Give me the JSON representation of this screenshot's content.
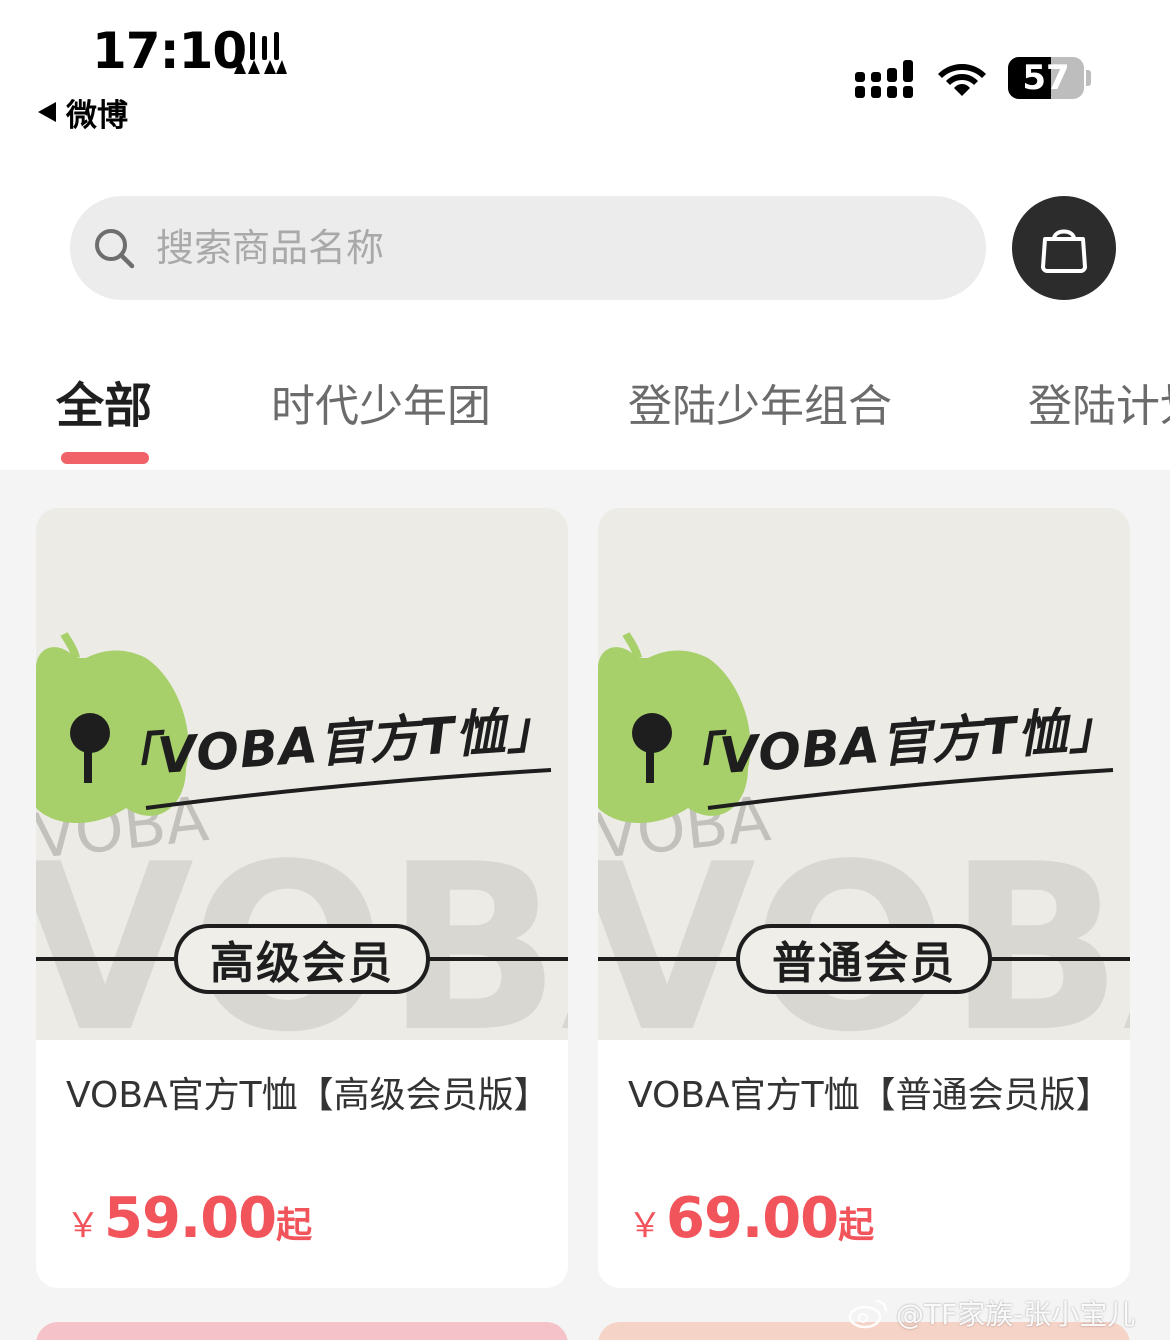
{
  "status_bar": {
    "time": "17:10",
    "back_app": "微博",
    "battery": "57",
    "battery_level_percent": 57
  },
  "search": {
    "placeholder": "搜索商品名称"
  },
  "tabs": [
    {
      "label": "全部",
      "active": true
    },
    {
      "label": "时代少年团",
      "active": false
    },
    {
      "label": "登陆少年组合",
      "active": false
    },
    {
      "label": "登陆计划",
      "active": false
    }
  ],
  "products": [
    {
      "image_brand": "VOBA",
      "image_badge": "高级会员",
      "image_heading": "「VOBA官方T恤」",
      "title": "VOBA官方T恤【高级会员版】",
      "currency": "￥",
      "price": "59.00",
      "price_suffix": "起"
    },
    {
      "image_brand": "VOBA",
      "image_badge": "普通会员",
      "image_heading": "「VOBA官方T恤」",
      "title": "VOBA官方T恤【普通会员版】",
      "currency": "￥",
      "price": "69.00",
      "price_suffix": "起"
    }
  ],
  "watermark": "@TF家族-张小宝儿",
  "colors": {
    "accent": "#f06267",
    "price": "#f2545b",
    "cart_button": "#2c2c2c",
    "logo_green": "#a7d06a"
  }
}
